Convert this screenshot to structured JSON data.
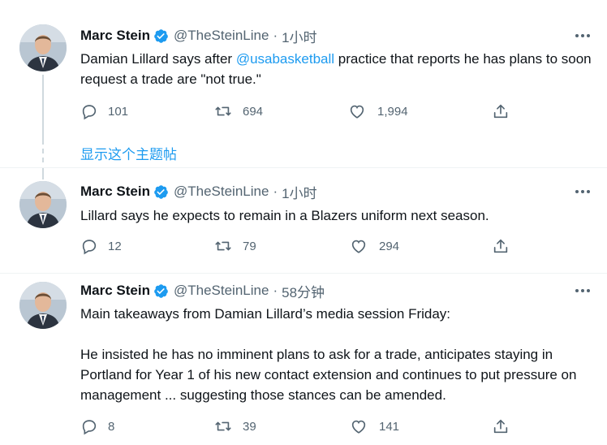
{
  "show_thread_label": "显示这个主题帖",
  "tweets": [
    {
      "name": "Marc Stein",
      "handle": "@TheSteinLine",
      "dot": "·",
      "time": "1小时",
      "text_before": "Damian Lillard says after ",
      "mention": "@usabasketball",
      "text_after": " practice that reports he has plans to soon request a trade are \"not true.\"",
      "replies": "101",
      "retweets": "694",
      "likes": "1,994"
    },
    {
      "name": "Marc Stein",
      "handle": "@TheSteinLine",
      "dot": "·",
      "time": "1小时",
      "text": "Lillard says he expects to remain in a Blazers uniform next season.",
      "replies": "12",
      "retweets": "79",
      "likes": "294"
    },
    {
      "name": "Marc Stein",
      "handle": "@TheSteinLine",
      "dot": "·",
      "time": "58分钟",
      "text_line1": "Main takeaways from Damian Lillard’s media session Friday:",
      "text_para2": "He insisted he has no imminent plans to ask for a trade, anticipates staying in Portland for Year 1 of his new contact extension and continues to put pressure on management ... suggesting those stances can be amended.",
      "replies": "8",
      "retweets": "39",
      "likes": "141"
    }
  ],
  "colors": {
    "accent": "#1d9bf0",
    "muted": "#536471",
    "text": "#0f1419"
  },
  "icons": [
    "verified-badge-icon",
    "more-icon",
    "reply-icon",
    "retweet-icon",
    "like-icon",
    "share-icon"
  ]
}
